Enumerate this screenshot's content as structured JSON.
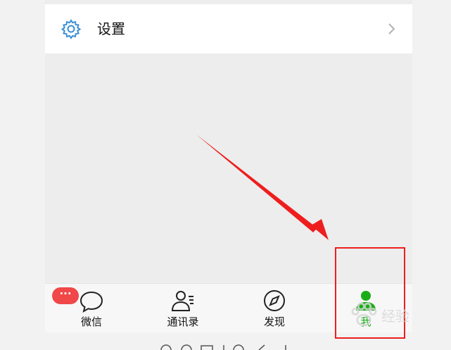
{
  "settings_row": {
    "label": "设置",
    "icon": "gear-icon",
    "chevron": "chevron-right-icon"
  },
  "tabbar": {
    "tabs": [
      {
        "label": "微信",
        "icon": "chat-bubble-icon",
        "badge": "···"
      },
      {
        "label": "通讯录",
        "icon": "contacts-icon"
      },
      {
        "label": "发现",
        "icon": "compass-icon"
      },
      {
        "label": "我",
        "icon": "person-icon",
        "active": true
      }
    ]
  },
  "annotation": {
    "arrow_color": "#ee1e1e",
    "box_color": "#ee1e1e"
  },
  "watermark": {
    "text": "经验"
  },
  "colors": {
    "accent": "#1aad19",
    "badge": "#f04848",
    "gear": "#3b8fd6"
  }
}
